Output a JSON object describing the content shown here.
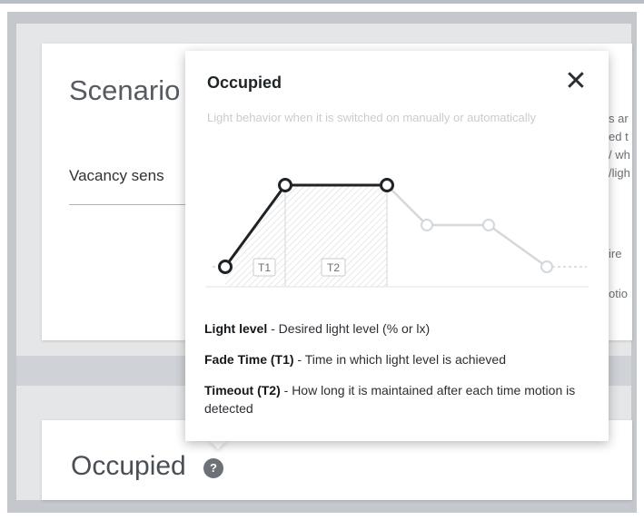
{
  "background": {
    "scenario_title": "Scenario",
    "vacancy_label": "Vacancy sens",
    "right_snippets": [
      "s ar",
      "ed t",
      "/ wh",
      "/ligh",
      "ire",
      "otio"
    ],
    "occupied_title": "Occupied",
    "help_glyph": "?"
  },
  "popover": {
    "title": "Occupied",
    "close_glyph": "✕",
    "subtitle": "Light behavior when it is switched on manually or automatically",
    "diagram": {
      "t1_label": "T1",
      "t2_label": "T2"
    },
    "legend": [
      {
        "term": "Light level",
        "desc": " - Desired light level (% or lx)"
      },
      {
        "term": "Fade Time (T1)",
        "desc": " - Time in which light level is achieved"
      },
      {
        "term": "Timeout (T2)",
        "desc": " - How long it is maintained after each time motion is detected"
      }
    ]
  },
  "colors": {
    "active_line": "#1f2326",
    "inactive_line": "#d5d8db",
    "hatch": "#d9dcdf"
  }
}
